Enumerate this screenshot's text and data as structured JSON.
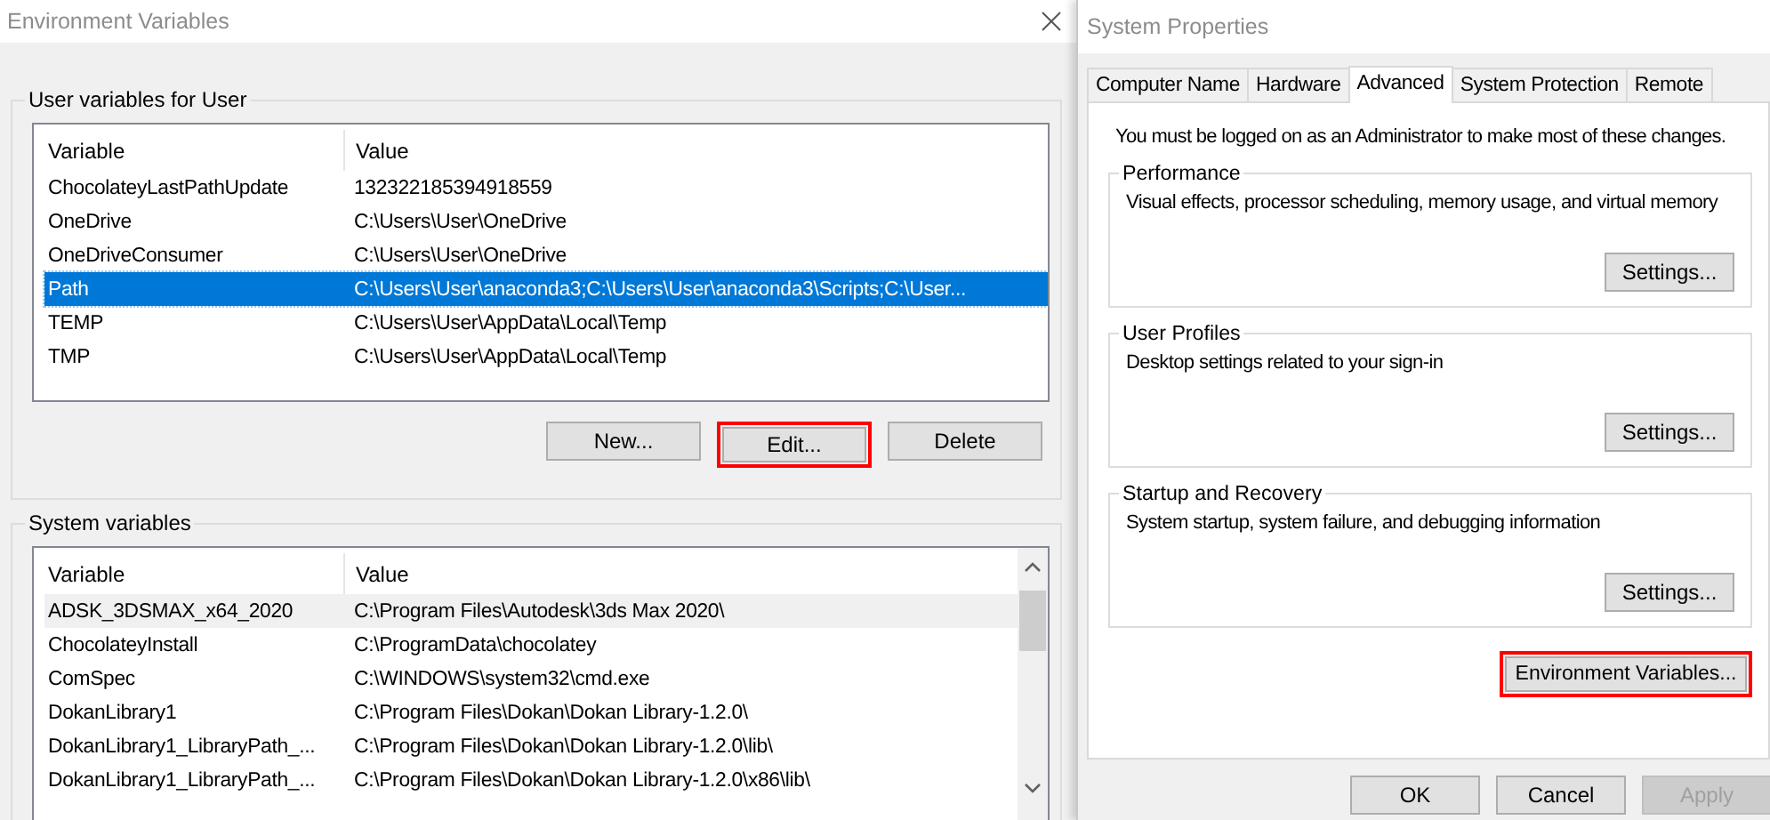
{
  "env_window": {
    "title": "Environment Variables",
    "user_variables": {
      "title": "User variables for User",
      "columns": [
        "Variable",
        "Value"
      ],
      "rows": [
        {
          "variable": "ChocolateyLastPathUpdate",
          "value": "132322185394918559",
          "selected": false,
          "hovered": false
        },
        {
          "variable": "OneDrive",
          "value": "C:\\Users\\User\\OneDrive",
          "selected": false,
          "hovered": false
        },
        {
          "variable": "OneDriveConsumer",
          "value": "C:\\Users\\User\\OneDrive",
          "selected": false,
          "hovered": false
        },
        {
          "variable": "Path",
          "value": "C:\\Users\\User\\anaconda3;C:\\Users\\User\\anaconda3\\Scripts;C:\\User...",
          "selected": true,
          "hovered": false
        },
        {
          "variable": "TEMP",
          "value": "C:\\Users\\User\\AppData\\Local\\Temp",
          "selected": false,
          "hovered": false
        },
        {
          "variable": "TMP",
          "value": "C:\\Users\\User\\AppData\\Local\\Temp",
          "selected": false,
          "hovered": false
        }
      ],
      "buttons": [
        {
          "label": "New...",
          "highlighted": false
        },
        {
          "label": "Edit...",
          "highlighted": true
        },
        {
          "label": "Delete",
          "highlighted": false
        }
      ]
    },
    "system_variables": {
      "title": "System variables",
      "columns": [
        "Variable",
        "Value"
      ],
      "rows": [
        {
          "variable": "ADSK_3DSMAX_x64_2020",
          "value": "C:\\Program Files\\Autodesk\\3ds Max 2020\\",
          "selected": false,
          "hovered": true
        },
        {
          "variable": "ChocolateyInstall",
          "value": "C:\\ProgramData\\chocolatey",
          "selected": false,
          "hovered": false
        },
        {
          "variable": "ComSpec",
          "value": "C:\\WINDOWS\\system32\\cmd.exe",
          "selected": false,
          "hovered": false
        },
        {
          "variable": "DokanLibrary1",
          "value": "C:\\Program Files\\Dokan\\Dokan Library-1.2.0\\",
          "selected": false,
          "hovered": false
        },
        {
          "variable": "DokanLibrary1_LibraryPath_...",
          "value": "C:\\Program Files\\Dokan\\Dokan Library-1.2.0\\lib\\",
          "selected": false,
          "hovered": false
        },
        {
          "variable": "DokanLibrary1_LibraryPath_...",
          "value": "C:\\Program Files\\Dokan\\Dokan Library-1.2.0\\x86\\lib\\",
          "selected": false,
          "hovered": false
        }
      ]
    }
  },
  "sys_window": {
    "title": "System Properties",
    "tabs": [
      {
        "label": "Computer Name",
        "selected": false
      },
      {
        "label": "Hardware",
        "selected": false
      },
      {
        "label": "Advanced",
        "selected": true
      },
      {
        "label": "System Protection",
        "selected": false
      },
      {
        "label": "Remote",
        "selected": false
      }
    ],
    "notice": "You must be logged on as an Administrator to make most of these changes.",
    "groups": [
      {
        "title": "Performance",
        "description": "Visual effects, processor scheduling, memory usage, and virtual memory",
        "button": "Settings..."
      },
      {
        "title": "User Profiles",
        "description": "Desktop settings related to your sign-in",
        "button": "Settings..."
      },
      {
        "title": "Startup and Recovery",
        "description": "System startup, system failure, and debugging information",
        "button": "Settings..."
      }
    ],
    "env_button": {
      "label": "Environment Variables...",
      "highlighted": true
    },
    "dialog_buttons": [
      {
        "label": "OK",
        "disabled": false
      },
      {
        "label": "Cancel",
        "disabled": false
      },
      {
        "label": "Apply",
        "disabled": true
      }
    ]
  }
}
